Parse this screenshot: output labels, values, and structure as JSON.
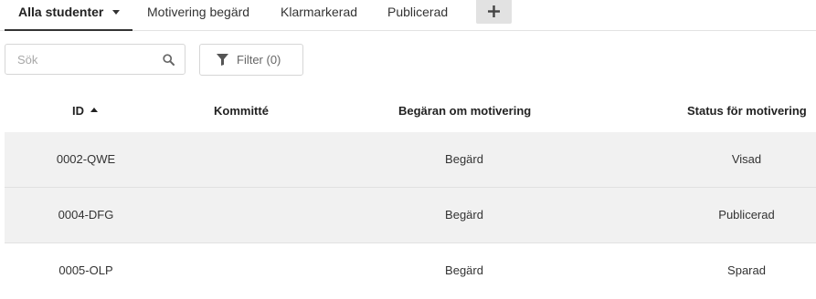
{
  "tabs": [
    {
      "label": "Alla studenter",
      "active": true,
      "has_dropdown": true
    },
    {
      "label": "Motivering begärd",
      "active": false
    },
    {
      "label": "Klarmarkerad",
      "active": false
    },
    {
      "label": "Publicerad",
      "active": false
    }
  ],
  "add_tab_icon": "plus-icon",
  "search": {
    "placeholder": "Sök",
    "value": "",
    "icon": "search-icon"
  },
  "filter": {
    "label": "Filter (0)",
    "icon": "funnel-icon"
  },
  "table": {
    "columns": [
      {
        "label": "ID",
        "sort": "ascending"
      },
      {
        "label": "Kommitté"
      },
      {
        "label": "Begäran om motivering"
      },
      {
        "label": "Status för motivering"
      }
    ],
    "rows": [
      {
        "id": "0002-QWE",
        "kommitte": "",
        "begaran": "Begärd",
        "status": "Visad"
      },
      {
        "id": "0004-DFG",
        "kommitte": "",
        "begaran": "Begärd",
        "status": "Publicerad"
      },
      {
        "id": "0005-OLP",
        "kommitte": "",
        "begaran": "Begärd",
        "status": "Sparad"
      }
    ]
  },
  "colors": {
    "row_shade": "#f1f1f1",
    "active_tab_underline": "#333333",
    "add_tab_bg": "#e2e2e2"
  }
}
